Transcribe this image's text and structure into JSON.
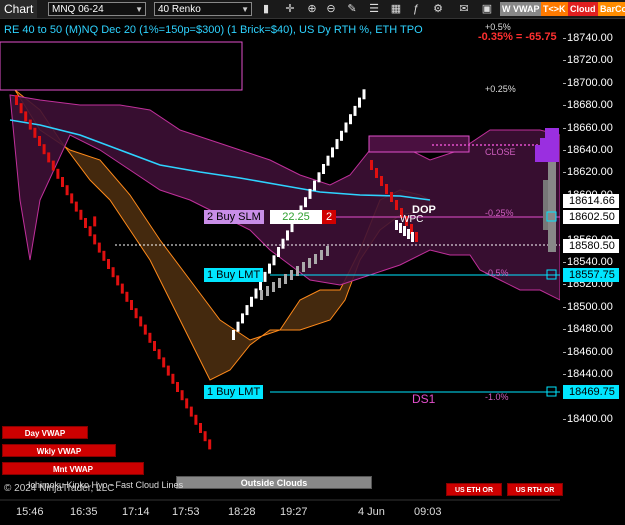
{
  "toolbar": {
    "chart_tab": "Chart",
    "instrument": "MNQ 06-24",
    "bar_type": "40 Renko",
    "vwap_label": "W VWAP",
    "tk_label": "T<>K",
    "cloud_label": "Cloud",
    "barcolor_label": "BarCo"
  },
  "info_line": "RE 40 to 50 (M)NQ Dec 20 (1%=150p=$300) (1 Brick=$40), US Dy RTH %, ETH TPO",
  "top_pct": "+0.5%",
  "top_change": "-0.35% = -65.75",
  "pct_levels": [
    {
      "label": "+0.25%"
    },
    {
      "label": "CLOSE"
    },
    {
      "label": "-0.25%"
    },
    {
      "label": "-0.5%"
    },
    {
      "label": "-1.0%"
    }
  ],
  "y_axis": {
    "ticks": [
      "18740.00",
      "18720.00",
      "18700.00",
      "18680.00",
      "18660.00",
      "18640.00",
      "18620.00",
      "18600.00",
      "18580.00",
      "18560.00",
      "18540.00",
      "18520.00",
      "18500.00",
      "18480.00",
      "18460.00",
      "18440.00",
      "18420.00",
      "18400.00"
    ],
    "price_boxes": [
      {
        "value": "18614.66",
        "style": "white"
      },
      {
        "value": "18602.50",
        "style": "white"
      },
      {
        "value": "18580.50",
        "style": "white"
      },
      {
        "value": "18557.75",
        "style": "cyan"
      },
      {
        "value": "18469.75",
        "style": "cyan"
      }
    ]
  },
  "x_axis": {
    "ticks": [
      "15:46",
      "16:35",
      "17:14",
      "17:53",
      "18:28",
      "19:27",
      "4 Jun",
      "09:03"
    ]
  },
  "orders": {
    "buy_slm": {
      "label": "2 Buy SLM",
      "price": "22.25",
      "qty": "2"
    },
    "buy_lmt_1": {
      "label": "1 Buy LMT"
    },
    "buy_lmt_2": {
      "label": "1 Buy LMT"
    }
  },
  "annotations": {
    "ds1": "DS1",
    "dop": "DOP",
    "wpc": "WPC"
  },
  "buttons": {
    "day_vwap": "Day VWAP",
    "wkly_vwap": "Wkly VWAP",
    "mnt_vwap": "Mnt VWAP",
    "outside_clouds": "Outside Clouds",
    "us_eth_or": "US ETH OR",
    "us_rth_or": "US RTH OR"
  },
  "copyright": "© 2024 NinjaTrader, LLC",
  "watermark": "Ichimoku Kinko Hyo - Fast Cloud Lines",
  "colors": {
    "cyan": "#00e6ff",
    "magenta": "#d05fc0",
    "red": "#e00000",
    "orange": "#ff8a1a"
  }
}
